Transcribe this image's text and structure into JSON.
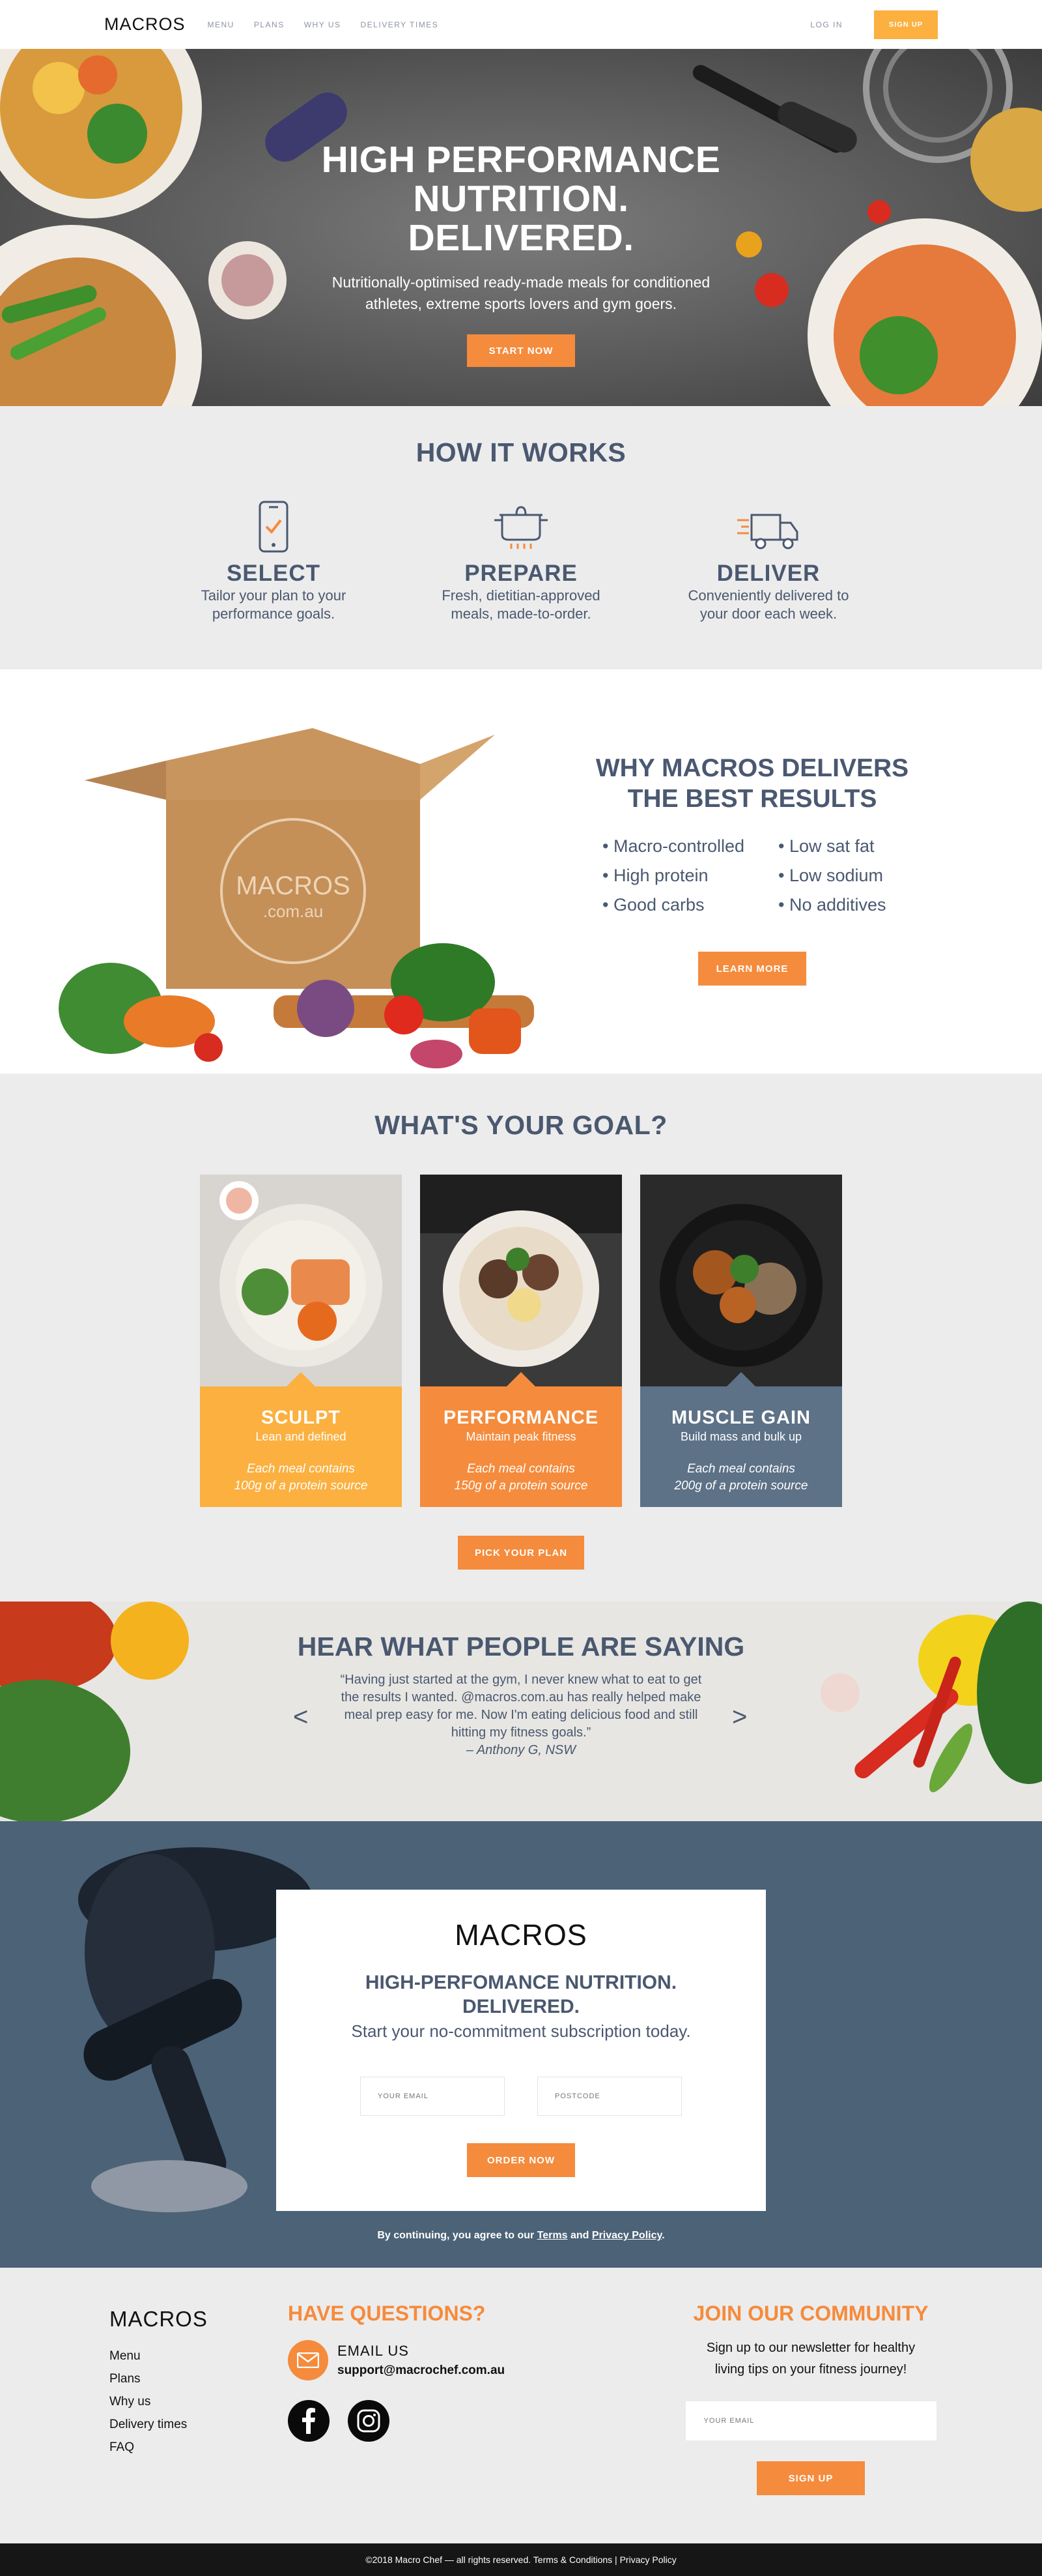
{
  "nav": {
    "logo": "MACROS",
    "links": [
      "MENU",
      "PLANS",
      "WHY US",
      "DELIVERY TIMES"
    ],
    "login": "LOG IN",
    "signup": "SIGN UP"
  },
  "hero": {
    "title_line1": "HIGH PERFORMANCE",
    "title_line2": "NUTRITION.",
    "title_line3": "DELIVERED.",
    "subtitle_line1": "Nutritionally-optimised ready-made meals for conditioned",
    "subtitle_line2": "athletes, extreme sports lovers and gym goers.",
    "cta": "START NOW"
  },
  "how": {
    "title": "HOW IT WORKS",
    "steps": [
      {
        "title": "SELECT",
        "line1": "Tailor your plan to your",
        "line2": "performance goals.",
        "icon": "phone-check-icon"
      },
      {
        "title": "PREPARE",
        "line1": "Fresh, dietitian-approved",
        "line2": "meals, made-to-order.",
        "icon": "cooking-pot-icon"
      },
      {
        "title": "DELIVER",
        "line1": "Conveniently delivered to",
        "line2": "your door each week.",
        "icon": "delivery-truck-icon"
      }
    ]
  },
  "why": {
    "title_line1": "WHY MACROS DELIVERS",
    "title_line2": "THE BEST RESULTS",
    "box_brand": "MACROS",
    "box_domain": ".com.au",
    "benefits": [
      "Macro-controlled",
      "Low sat fat",
      "High protein",
      "Low sodium",
      "Good carbs",
      "No additives"
    ],
    "cta": "LEARN MORE"
  },
  "goal": {
    "title": "WHAT'S YOUR GOAL?",
    "cards": [
      {
        "title": "SCULPT",
        "sub": "Lean and defined",
        "desc1": "Each meal contains",
        "desc2": "100g of a protein source",
        "color": "#fbb040"
      },
      {
        "title": "PERFORMANCE",
        "sub": "Maintain peak fitness",
        "desc1": "Each meal contains",
        "desc2": "150g of a protein source",
        "color": "#f58b3c"
      },
      {
        "title": "MUSCLE GAIN",
        "sub": "Build mass and bulk up",
        "desc1": "Each meal contains",
        "desc2": "200g of a protein source",
        "color": "#5d7187"
      }
    ],
    "cta": "PICK YOUR PLAN"
  },
  "testimonial": {
    "title": "HEAR WHAT PEOPLE ARE SAYING",
    "quote": "“Having just started at the gym, I never knew what to eat to get the results I wanted. @macros.com.au has really helped make meal prep easy for me. Now I'm eating delicious food and still hitting my fitness goals.”",
    "author": "– Anthony G, NSW",
    "prev": "<",
    "next": ">"
  },
  "cta": {
    "logo": "MACROS",
    "title_line1": "HIGH-PERFOMANCE NUTRITION.",
    "title_line2": "DELIVERED.",
    "sub": "Start your no-commitment subscription today.",
    "email_placeholder": "YOUR EMAIL",
    "postcode_placeholder": "POSTCODE",
    "button": "ORDER NOW",
    "terms_prefix": "By continuing, you agree to our ",
    "terms": "Terms",
    "and": " and ",
    "privacy": "Privacy Policy",
    "period": "."
  },
  "footer": {
    "logo": "MACROS",
    "links": [
      "Menu",
      "Plans",
      "Why us",
      "Delivery times",
      "FAQ"
    ],
    "questions_title": "HAVE QUESTIONS?",
    "email_label": "EMAIL US",
    "email": "support@macrochef.com.au",
    "community_title": "JOIN OUR COMMUNITY",
    "community_line1": "Sign up to our newsletter for healthy",
    "community_line2": "living tips on your fitness journey!",
    "newsletter_placeholder": "YOUR EMAIL",
    "signup": "SIGN UP",
    "copyright": "©2018 Macro Chef — all rights reserved. Terms & Conditions | Privacy Policy"
  }
}
